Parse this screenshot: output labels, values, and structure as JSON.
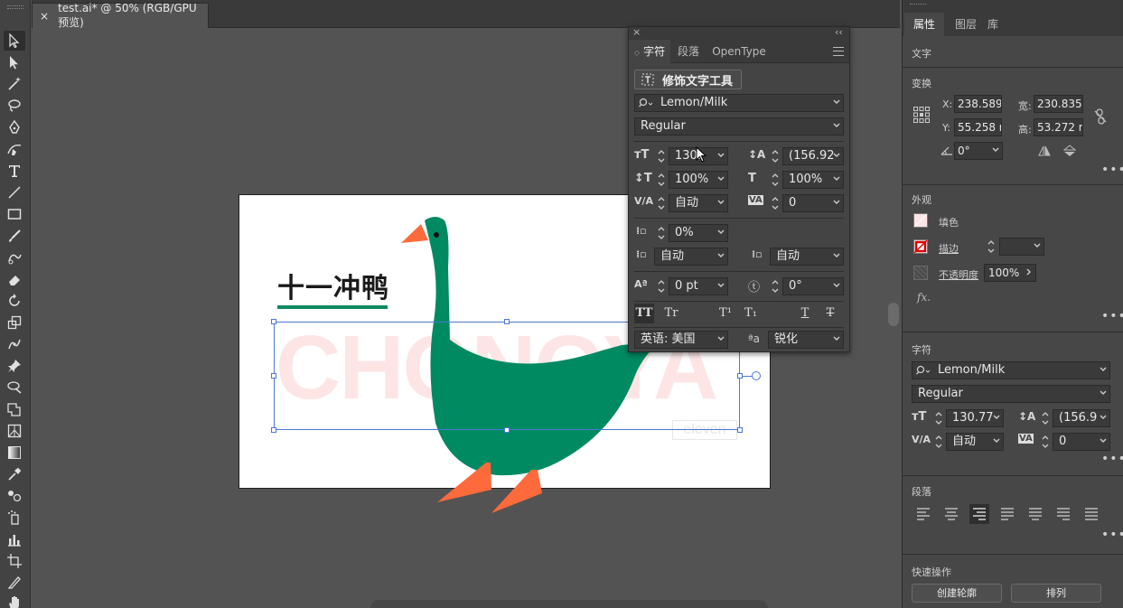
{
  "document": {
    "tab_title": "test.ai* @ 50% (RGB/GPU 预览)",
    "close_glyph": "×"
  },
  "artboard": {
    "heading": "十一冲鸭",
    "big_text": "CHONGYA",
    "small_text": "eleven",
    "colors": {
      "green": "#008a62",
      "orange": "#ff6a3d",
      "pink": "#fde5e5",
      "underline": "#0f8a5f"
    }
  },
  "char_panel": {
    "close": "×",
    "collapse": "‹‹",
    "tabs": [
      "字符",
      "段落",
      "OpenType"
    ],
    "touch_type_button": "修饰文字工具",
    "font_family": "Lemon/Milk",
    "font_style": "Regular",
    "font_size": "130.",
    "leading": "(156.92",
    "vertical_scale": "100%",
    "horizontal_scale": "100%",
    "kerning": "自动",
    "tracking": "0",
    "tsume": "0%",
    "aki_left": "自动",
    "aki_right": "自动",
    "baseline_shift": "0 pt",
    "rotation": "0°",
    "language": "英语: 美国",
    "antialias": "锐化",
    "aa_label": "ªa",
    "format_buttons": [
      "TT",
      "Tr",
      "T¹",
      "T₁",
      "T",
      "T"
    ]
  },
  "right_panel": {
    "tabs": [
      "属性",
      "图层",
      "库"
    ],
    "selection_type": "文字",
    "transform": {
      "title": "变换",
      "x_label": "X:",
      "x_value": "238.589",
      "y_label": "Y:",
      "y_value": "55.258 r",
      "w_label": "宽:",
      "w_value": "230.835",
      "h_label": "高:",
      "h_value": "53.272 r",
      "angle_value": "0°"
    },
    "appearance": {
      "title": "外观",
      "fill_label": "填色",
      "stroke_label": "描边",
      "opacity_label": "不透明度",
      "opacity_value": "100%",
      "fx_label": "fx."
    },
    "character": {
      "title": "字符",
      "font_family": "Lemon/Milk",
      "font_style": "Regular",
      "font_size": "130.77",
      "leading": "(156.9",
      "kerning": "自动",
      "tracking": "0"
    },
    "paragraph": {
      "title": "段落"
    },
    "quick_actions": {
      "title": "快速操作",
      "create_outlines": "创建轮廓",
      "arrange": "排列"
    },
    "more": "•••"
  }
}
